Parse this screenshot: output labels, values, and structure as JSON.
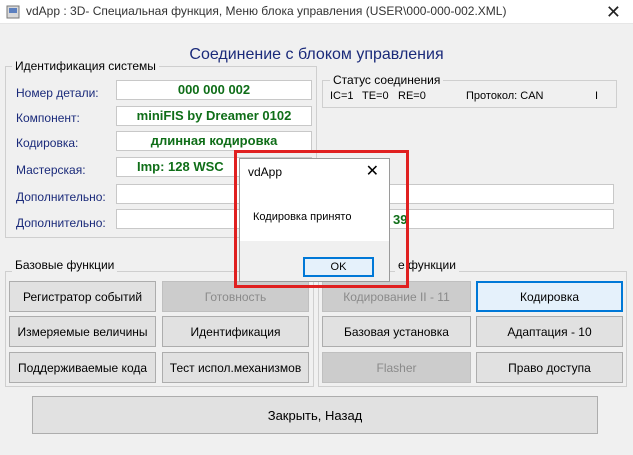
{
  "window": {
    "title": "vdApp : 3D- Специальная функция,  Меню блока управления (USER\\000-000-002.XML)",
    "close_icon": "close-icon",
    "app_icon": "app-icon"
  },
  "heading": "Соединение с блоком управления",
  "system_id": {
    "group_label": "Идентификация системы",
    "rows": [
      {
        "label": "Номер детали:",
        "value": "000 000 002"
      },
      {
        "label": "Компонент:",
        "value": "miniFIS by Dreamer  0102"
      },
      {
        "label": "Кодировка:",
        "value": "длинная кодировка"
      },
      {
        "label": "Мастерская:",
        "value": "Imp: 128     WSC"
      },
      {
        "label": "Дополнительно:",
        "value": ""
      },
      {
        "label": "Дополнительно:",
        "value": ""
      }
    ],
    "extra_partial": "39"
  },
  "status": {
    "group_label": "Статус соединения",
    "ic": "IC=1",
    "te": "TE=0",
    "re": "RE=0",
    "protocol": "Протокол: CAN",
    "sep": "I"
  },
  "basic": {
    "group_label": "Базовые функции",
    "buttons": [
      "Регистратор событий",
      "Готовность",
      "Измеряемые величины",
      "Идентификация",
      "Поддерживаемые кода",
      "Тест испол.механизмов"
    ]
  },
  "advanced": {
    "group_label_partial": "е функции",
    "buttons": [
      "Кодирование II - 11",
      "Кодировка",
      "Базовая установка",
      "Адаптация - 10",
      "Flasher",
      "Право доступа"
    ]
  },
  "close_button": "Закрыть, Назад",
  "dialog": {
    "title": "vdApp",
    "message": "Кодировка принято",
    "ok": "OK"
  }
}
